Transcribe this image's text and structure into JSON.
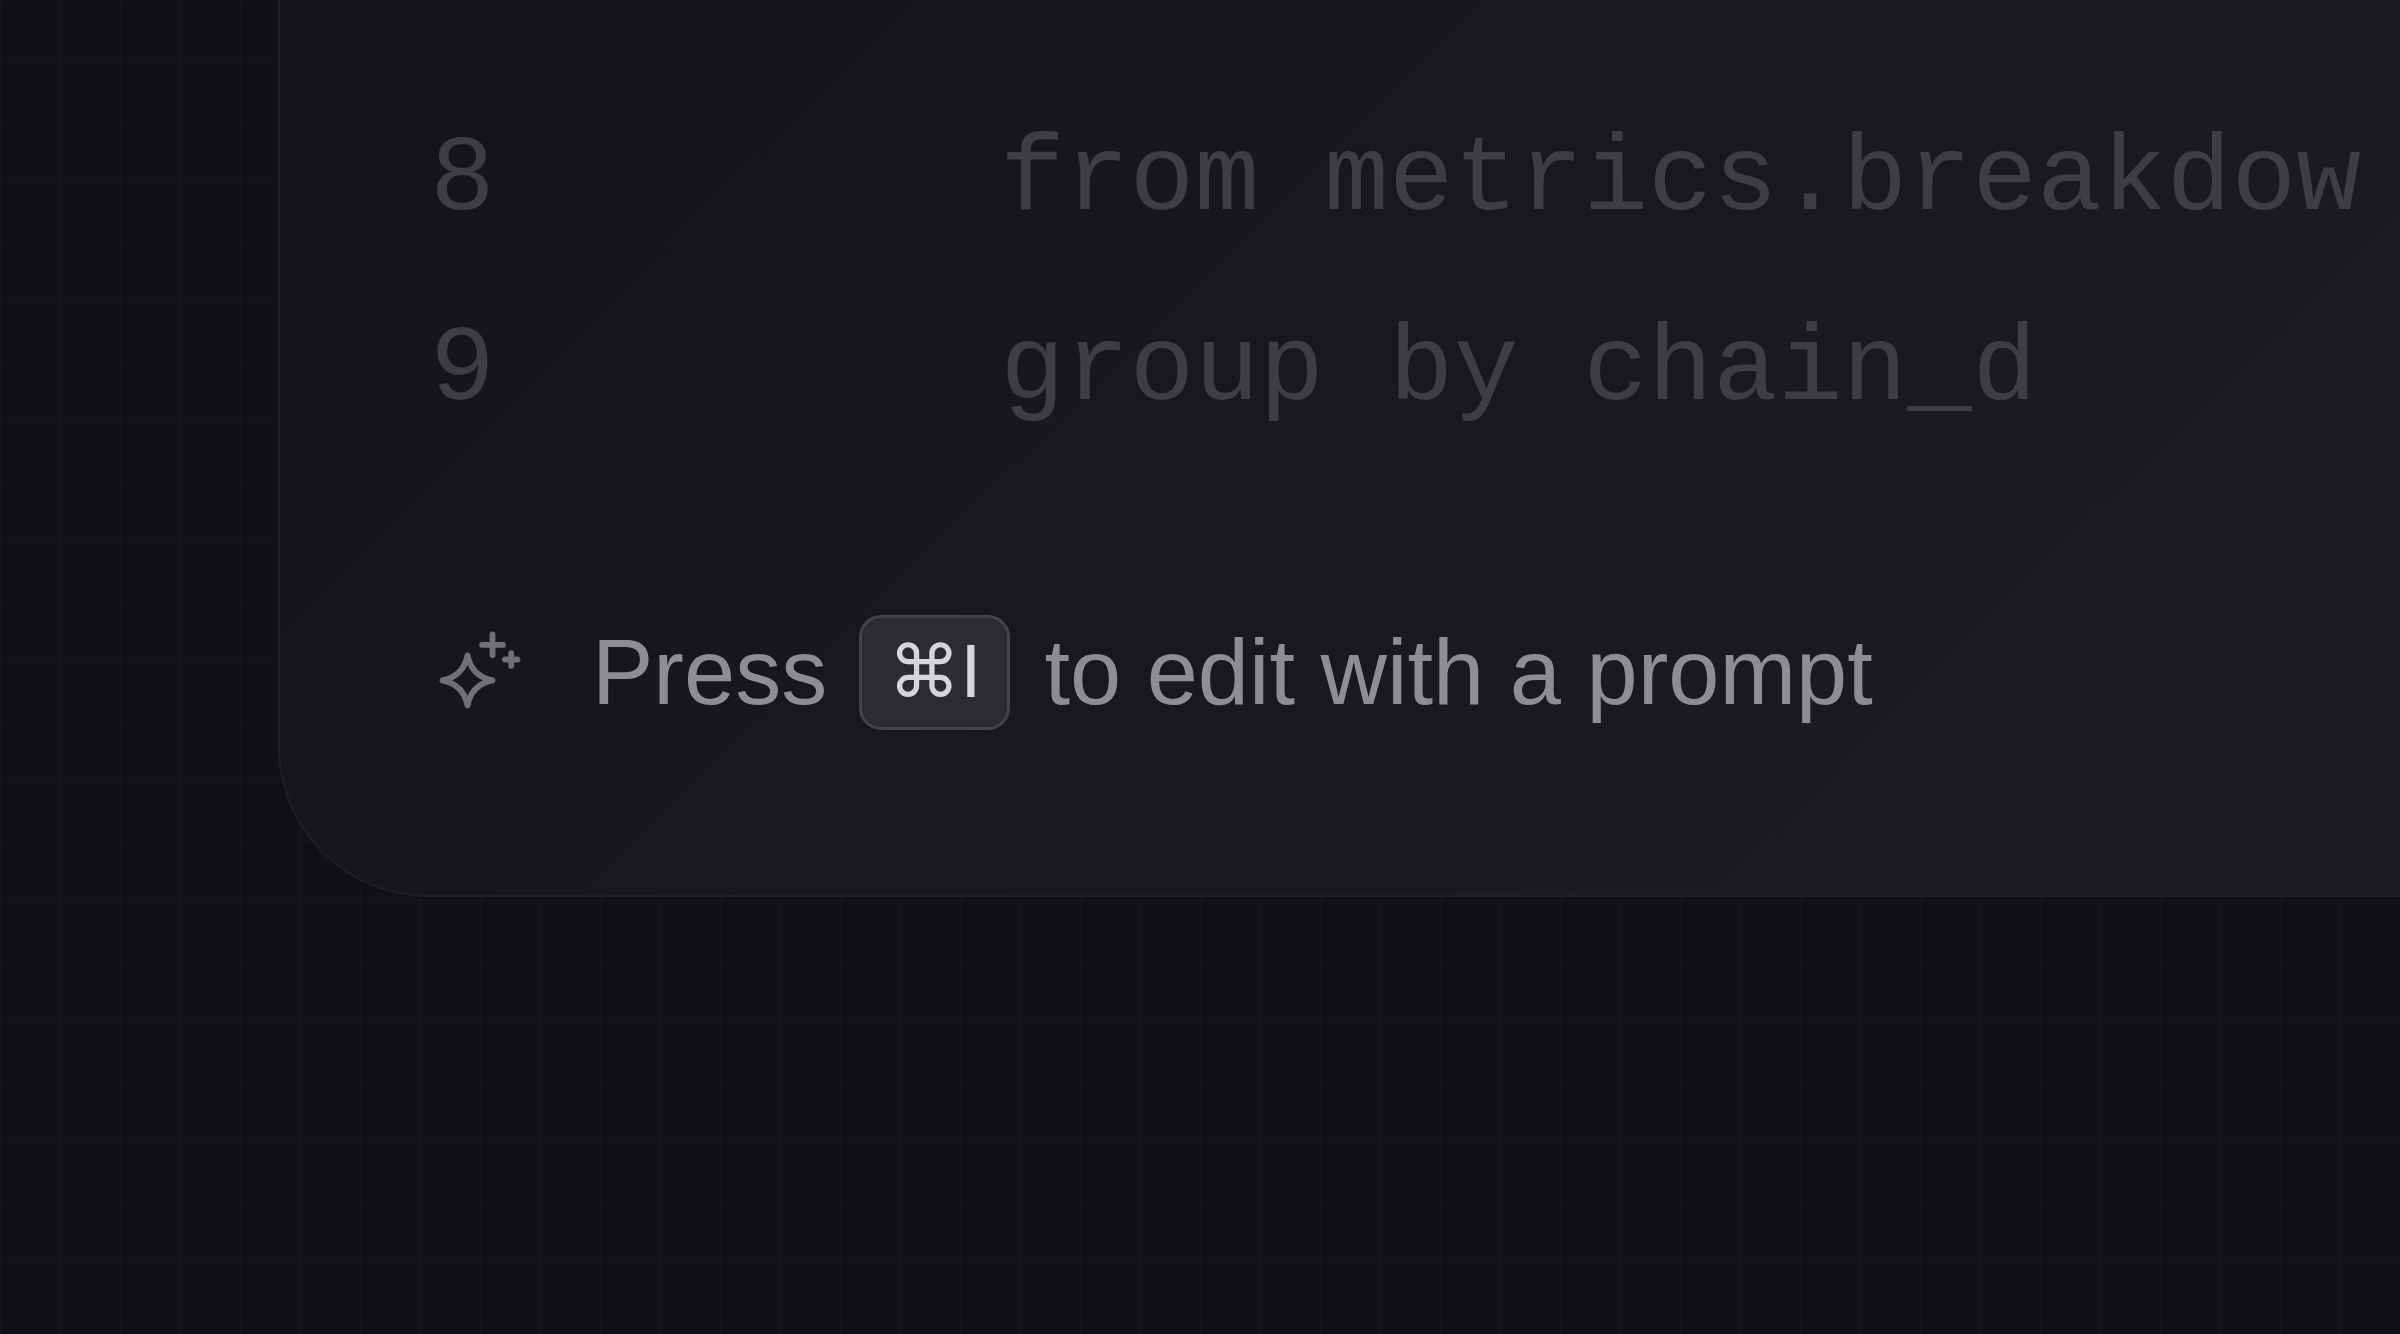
{
  "code_lines": [
    {
      "number": "8",
      "text": "from metrics.breakdow"
    },
    {
      "number": "9",
      "text": "group by chain_d"
    }
  ],
  "prompt_hint": {
    "before": "Press",
    "key": "⌘I",
    "after": "to edit with a prompt"
  }
}
